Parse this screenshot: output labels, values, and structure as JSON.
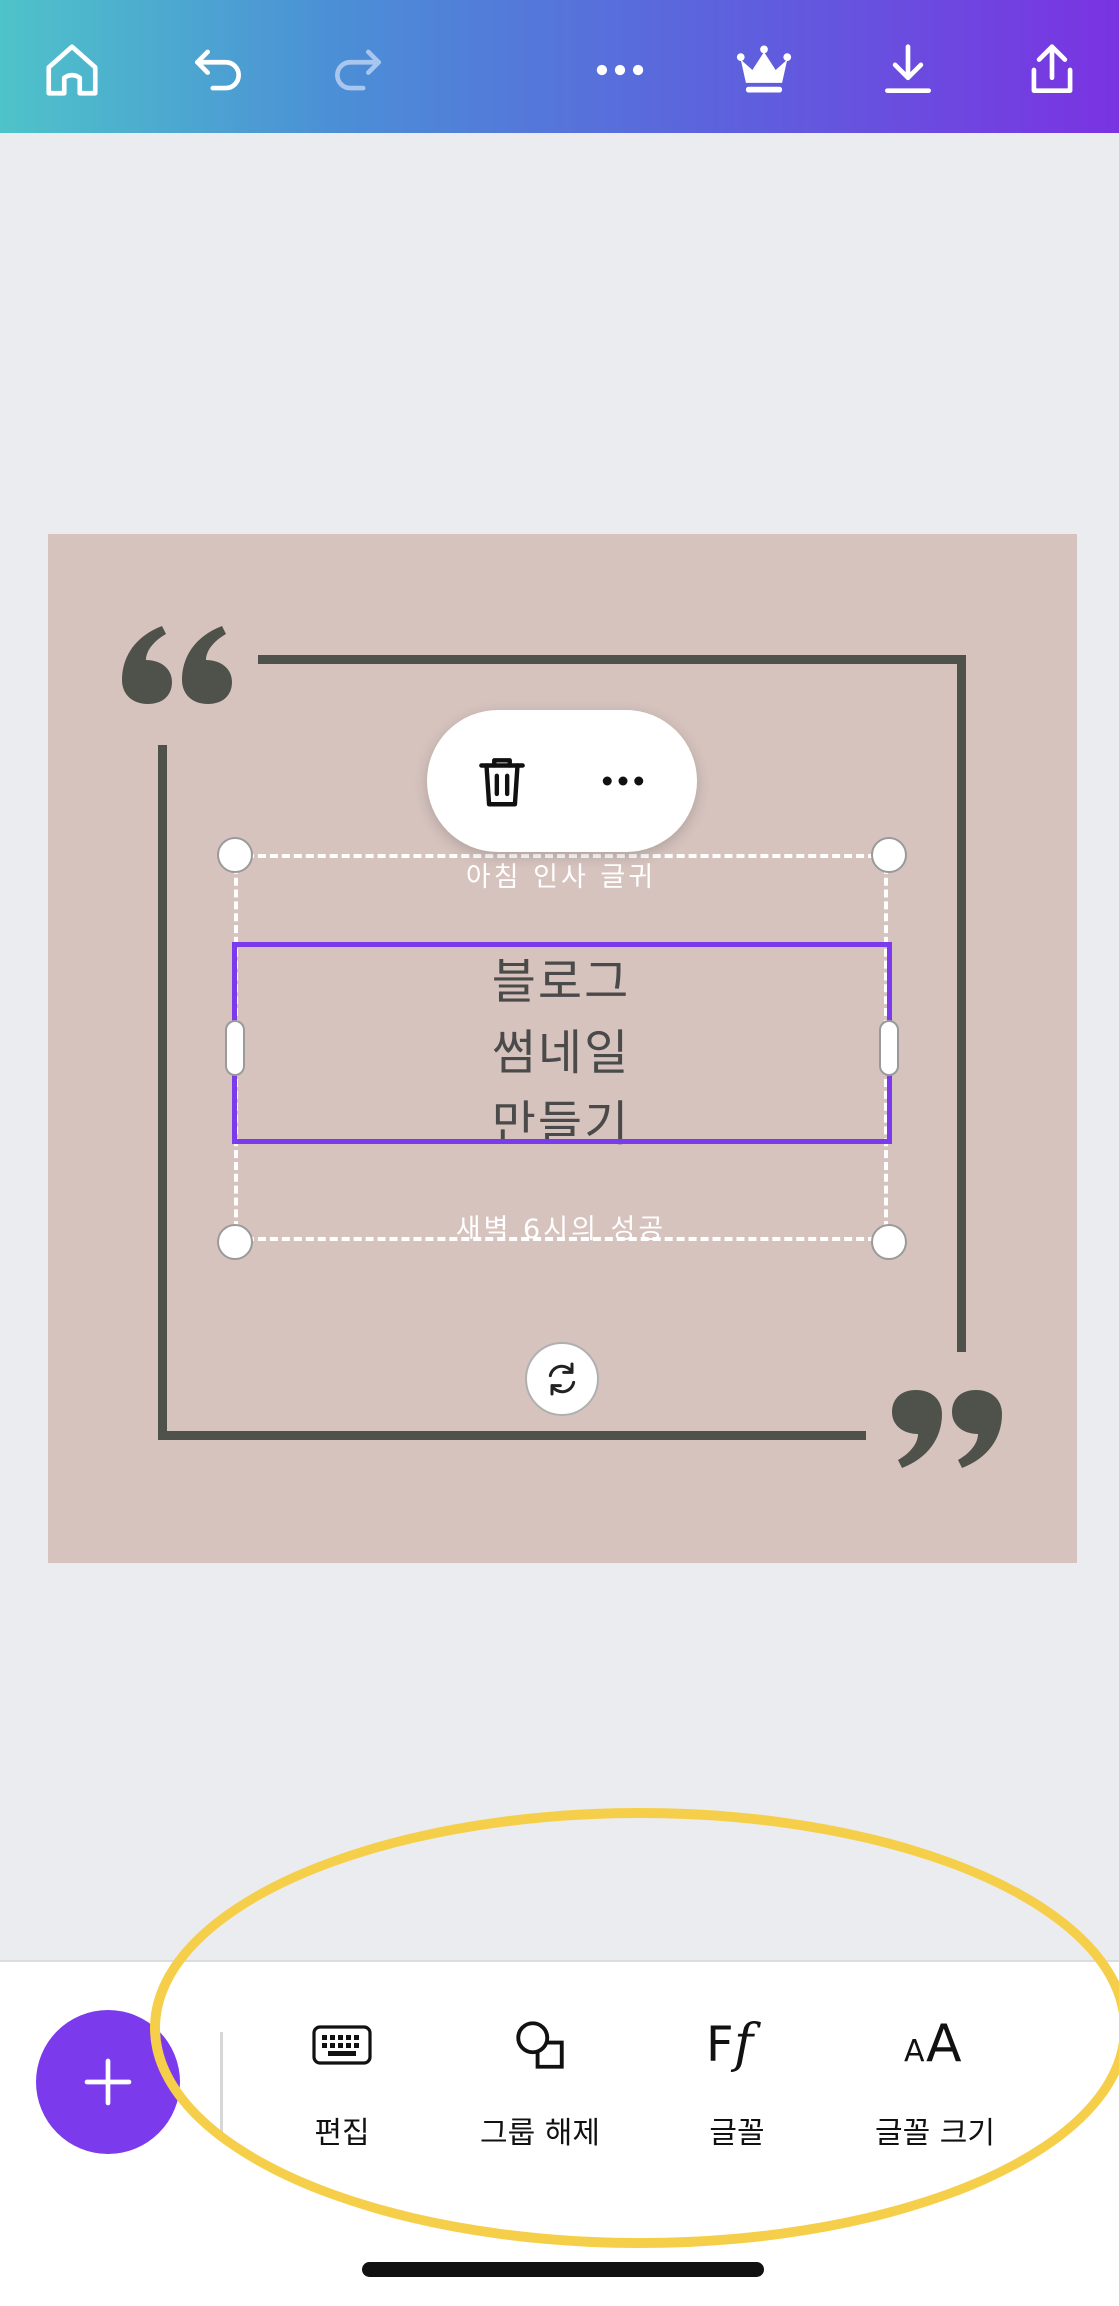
{
  "toolbar": {
    "icons": [
      "home-icon",
      "undo-icon",
      "redo-icon",
      "more-icon",
      "crown-icon",
      "download-icon",
      "share-icon"
    ]
  },
  "design": {
    "top_text": "아침 인사 글귀",
    "main_lines": [
      "블로그",
      "썸네일",
      "만들기"
    ],
    "bottom_text": "새벽 6시의 성공",
    "background_color": "#d6c3be",
    "accent_color": "#4f524b"
  },
  "context_menu": {
    "icons": [
      "trash-icon",
      "more-icon"
    ]
  },
  "bottom_toolbar": {
    "add_icon": "plus-icon",
    "tools": [
      {
        "label": "편집",
        "icon": "keyboard-icon"
      },
      {
        "label": "그룹 해제",
        "icon": "ungroup-icon"
      },
      {
        "label": "글꼴",
        "icon": "font-icon"
      },
      {
        "label": "글꼴 크기",
        "icon": "font-size-icon"
      }
    ]
  },
  "colors": {
    "brand_purple": "#7c3aed",
    "highlight_yellow": "#f6cf4a"
  }
}
